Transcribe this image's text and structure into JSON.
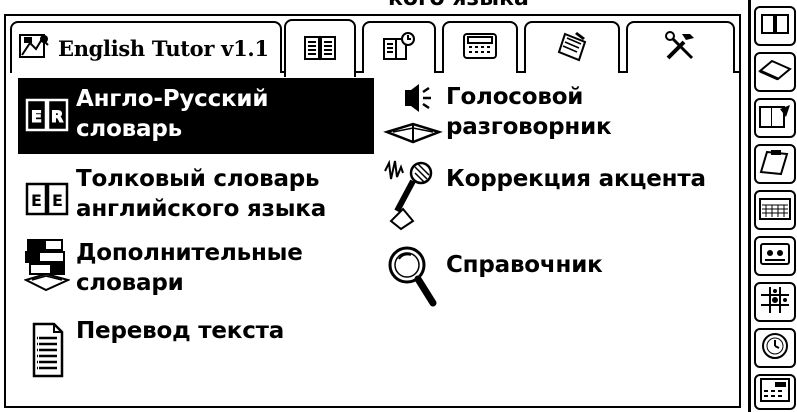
{
  "window": {
    "top_cropped_text": "кого языка"
  },
  "tabs": {
    "title_label": "English Tutor v1.1",
    "items": [
      {
        "name": "dictionary-tab-icon"
      },
      {
        "name": "phrasebook-tab-icon"
      },
      {
        "name": "calculator-tab-icon"
      },
      {
        "name": "notebook-tab-icon"
      },
      {
        "name": "tools-tab-icon"
      }
    ],
    "active_index": 0
  },
  "menu": {
    "items": [
      {
        "line1": "Англо-Русский",
        "line2": "словарь",
        "icon": "english-russian-dictionary-icon",
        "selected": true
      },
      {
        "line1": "Толковый словарь",
        "line2": "английского языка",
        "icon": "explanatory-dictionary-icon",
        "selected": false
      },
      {
        "line1": "Дополнительные",
        "line2": "словари",
        "icon": "stack-of-books-icon",
        "selected": false
      },
      {
        "line1": "Перевод текста",
        "line2": "",
        "icon": "document-text-icon",
        "selected": false
      },
      {
        "line1": "Голосовой",
        "line2": "разговорник",
        "icon": "voice-phrasebook-icon",
        "selected": false
      },
      {
        "line1": "Коррекция акцента",
        "line2": "",
        "icon": "microphone-icon",
        "selected": false
      },
      {
        "line1": "Справочник",
        "line2": "",
        "icon": "magnifier-icon",
        "selected": false
      }
    ]
  },
  "sidebar": {
    "buttons": [
      "open-book-icon",
      "eraser-icon",
      "notepad-pen-icon",
      "clipboard-icon",
      "calendar-icon",
      "cassette-icon",
      "tic-tac-toe-icon",
      "clock-icon",
      "calculator-icon"
    ]
  }
}
